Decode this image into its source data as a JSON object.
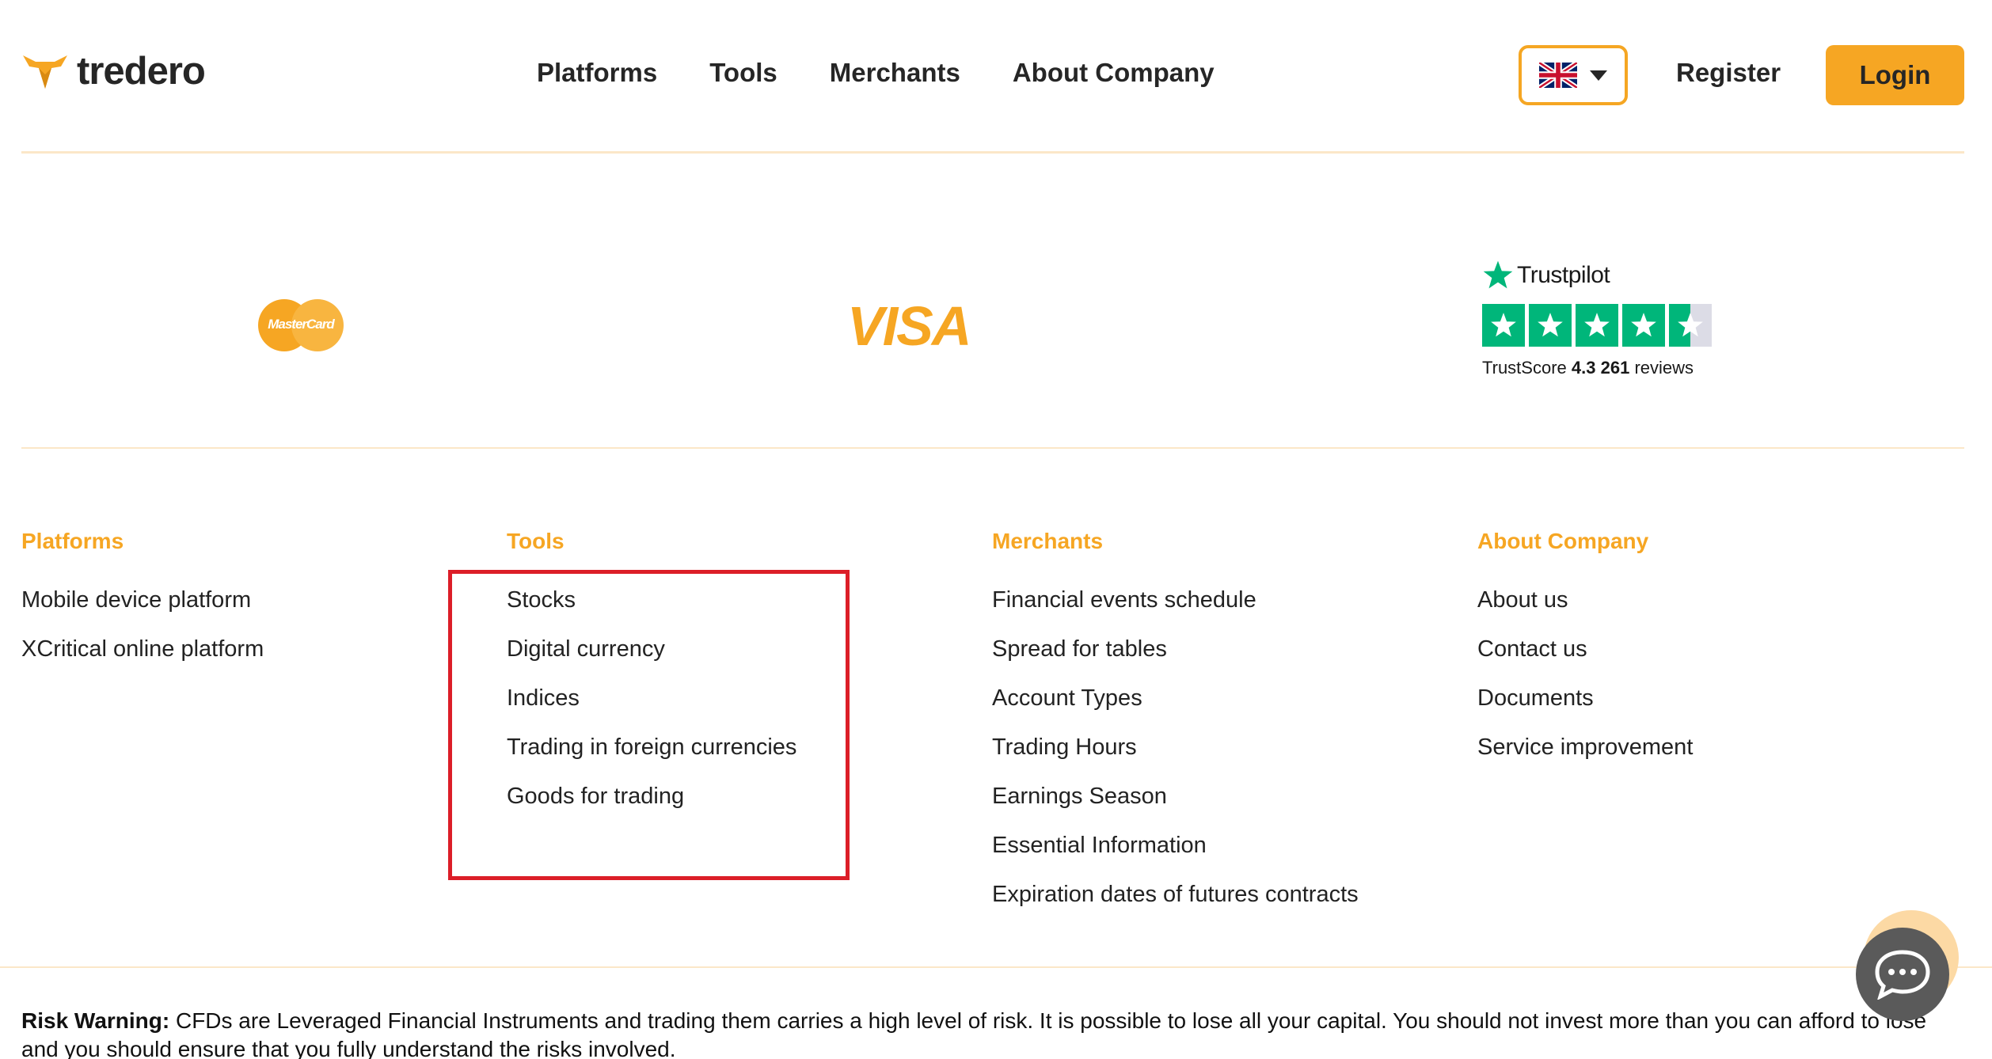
{
  "header": {
    "logo_text": "tredero",
    "nav": [
      {
        "label": "Platforms"
      },
      {
        "label": "Tools"
      },
      {
        "label": "Merchants"
      },
      {
        "label": "About Company"
      }
    ],
    "language_icon": "uk-flag-icon",
    "register_label": "Register",
    "login_label": "Login"
  },
  "payments": {
    "mastercard_text": "MasterCard",
    "visa_text": "VISA",
    "trustpilot": {
      "name": "Trustpilot",
      "rating_stars": 4.3,
      "score_prefix": "TrustScore",
      "score": "4.3",
      "review_count": "261",
      "reviews_suffix": "reviews"
    }
  },
  "footer": {
    "columns": [
      {
        "heading": "Platforms",
        "links": [
          "Mobile device platform",
          "XCritical online platform"
        ]
      },
      {
        "heading": "Tools",
        "links": [
          "Stocks",
          "Digital currency",
          "Indices",
          "Trading in foreign currencies",
          "Goods for trading"
        ]
      },
      {
        "heading": "Merchants",
        "links": [
          "Financial events schedule",
          "Spread for tables",
          "Account Types",
          "Trading Hours",
          "Earnings Season",
          "Essential Information",
          "Expiration dates of futures contracts"
        ]
      },
      {
        "heading": "About Company",
        "links": [
          "About us",
          "Contact us",
          "Documents",
          "Service improvement"
        ]
      }
    ]
  },
  "risk_warning": {
    "label": "Risk Warning:",
    "text": "CFDs are Leveraged Financial Instruments and trading them carries a high level of risk. It is possible to lose all your capital. You should not invest more than you can afford to lose and you should ensure that you fully understand the risks involved."
  },
  "colors": {
    "accent": "#f6a623",
    "highlight_box": "#dc1e28",
    "trustpilot_green": "#00b67a",
    "chat": "#5a5a5a"
  },
  "chat": {
    "icon": "chat-bubble-icon"
  }
}
